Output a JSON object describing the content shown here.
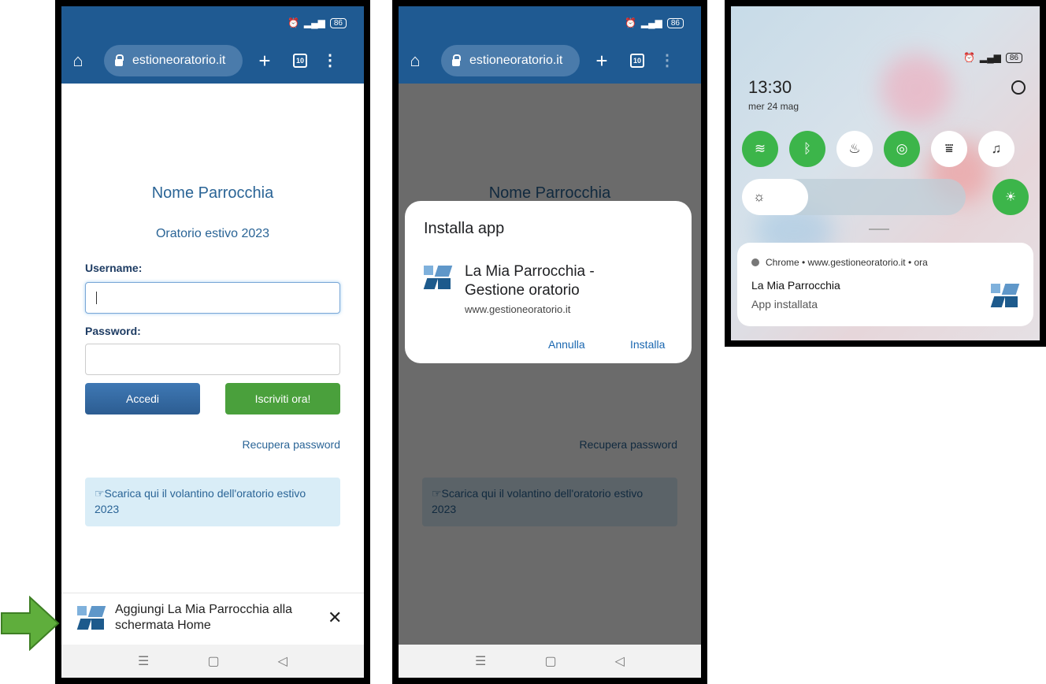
{
  "status": {
    "battery": "86"
  },
  "browser": {
    "url": "estioneoratorio.it",
    "tab_count": "10"
  },
  "login": {
    "parish_title": "Nome Parrocchia",
    "subtitle": "Oratorio estivo 2023",
    "username_label": "Username:",
    "password_label": "Password:",
    "login_button": "Accedi",
    "signup_button": "Iscriviti ora!",
    "recover_link": "Recupera password",
    "flyer_text": "☞Scarica qui il volantino dell'oratorio estivo 2023"
  },
  "banner": {
    "text": "Aggiungi La Mia Parrocchia alla schermata Home",
    "close": "✕"
  },
  "nav": {
    "recents": "☰",
    "home": "▢",
    "back": "◁"
  },
  "install_dialog": {
    "title": "Installa app",
    "app_name": "La Mia Parrocchia - Gestione oratorio",
    "app_url": "www.gestioneoratorio.it",
    "cancel": "Annulla",
    "install": "Installa"
  },
  "quick_settings": {
    "time": "13:30",
    "date": "mer 24 mag",
    "notification": {
      "source": "Chrome • www.gestioneoratorio.it • ora",
      "title": "La Mia Parrocchia",
      "body": "App installata"
    }
  },
  "colors": {
    "brand_blue": "#1f5a92",
    "success_green": "#4aa03c",
    "toggle_on": "#3cb54a",
    "arrow": "#5fae3c"
  },
  "icons": [
    "home-icon",
    "lock-icon",
    "plus-icon",
    "tabs-icon",
    "menu-dots-icon",
    "close-icon",
    "wifi-icon",
    "bluetooth-icon",
    "flashlight-icon",
    "location-icon",
    "hotspot-icon",
    "bell-icon",
    "brightness-icon",
    "auto-brightness-icon",
    "settings-icon",
    "arrow-right-icon"
  ]
}
